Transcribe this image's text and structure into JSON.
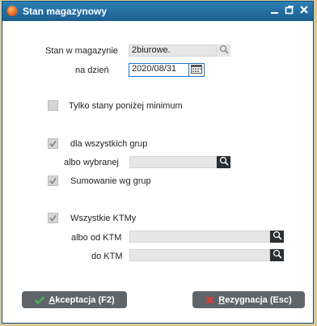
{
  "window": {
    "title": "Stan magazynowy"
  },
  "fields": {
    "stan_label": "Stan w magazynie",
    "stan_value": "2biurowe.",
    "date_label": "na dzień",
    "date_value": "2020/08/31"
  },
  "options": {
    "min_label": "Tylko stany poniżej minimum",
    "all_groups_label": "dla wszystkich grup",
    "or_selected_label": "albo wybranej",
    "sum_groups_label": "Sumowanie wg grup",
    "all_ktm_label": "Wszystkie KTMy",
    "from_ktm_label": "albo od KTM",
    "to_ktm_label": "do KTM"
  },
  "buttons": {
    "accept_hotkey": "A",
    "accept_rest": "kceptacja (F2)",
    "cancel_hotkey": "R",
    "cancel_rest": "ezygnacja (Esc)"
  },
  "colors": {
    "titlebar": "#1b5f91",
    "button": "#5f6469",
    "accept_icon": "#4caf50",
    "cancel_icon": "#e53935"
  }
}
